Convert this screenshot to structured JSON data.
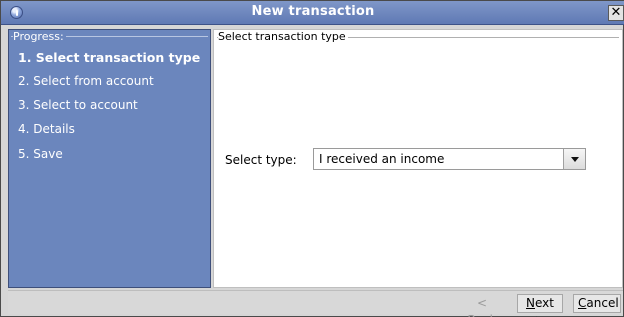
{
  "window": {
    "title": "New transaction"
  },
  "progress": {
    "legend": "Progress:",
    "steps": [
      {
        "label": "1. Select transaction type"
      },
      {
        "label": "2. Select from account"
      },
      {
        "label": "3. Select to account"
      },
      {
        "label": "4. Details"
      },
      {
        "label": "5. Save"
      }
    ]
  },
  "content": {
    "legend": "Select transaction type",
    "select_label": "Select type:",
    "select_value": "I received an income"
  },
  "buttons": {
    "back_prefix": "< ",
    "back_mnemonic": "B",
    "back_rest": "ack",
    "next_mnemonic": "N",
    "next_rest": "ext >",
    "cancel_mnemonic": "C",
    "cancel_rest": "ancel"
  },
  "colors": {
    "titlebar": "#6b86bd",
    "progress_panel": "#6b86bd"
  },
  "icons": {
    "app": "info-icon",
    "close": "close-icon",
    "dropdown": "chevron-down-icon"
  }
}
